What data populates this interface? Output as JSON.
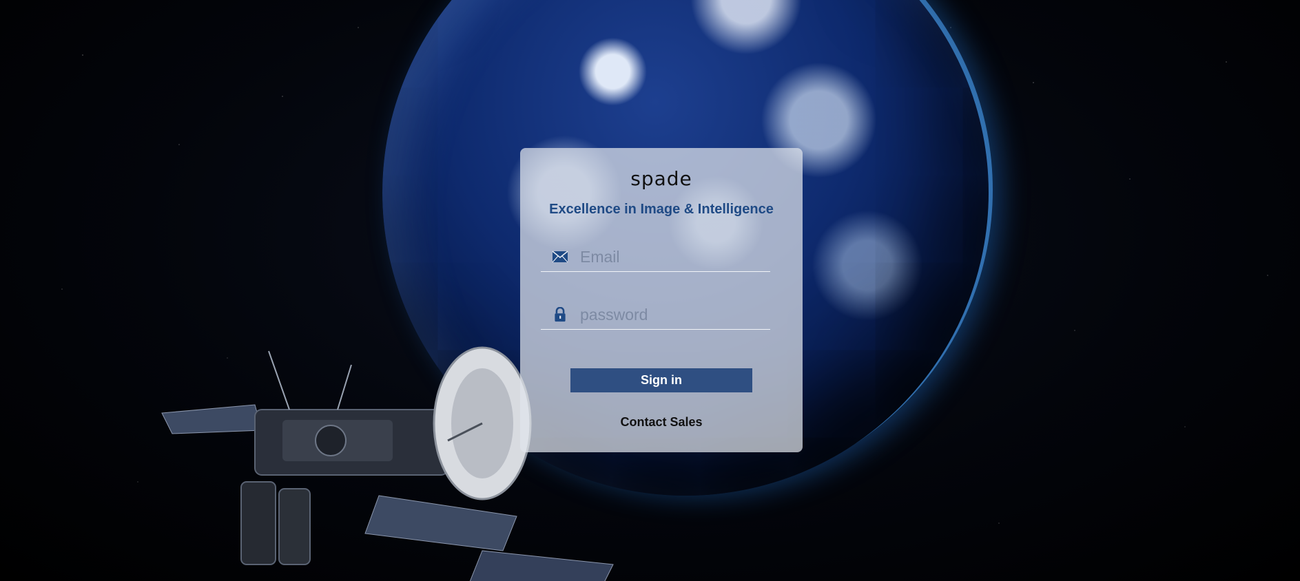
{
  "brand": {
    "logo_text": "spade",
    "tagline": "Excellence in Image & Intelligence"
  },
  "form": {
    "email_placeholder": "Email",
    "email_value": "",
    "email_icon": "envelope-icon",
    "password_placeholder": "password",
    "password_value": "",
    "password_icon": "lock-icon",
    "signin_label": "Sign in",
    "contact_label": "Contact Sales"
  },
  "colors": {
    "accent": "#2f4f82",
    "tagline": "#1f4a85",
    "card_background": "rgba(225,228,236,0.72)"
  }
}
